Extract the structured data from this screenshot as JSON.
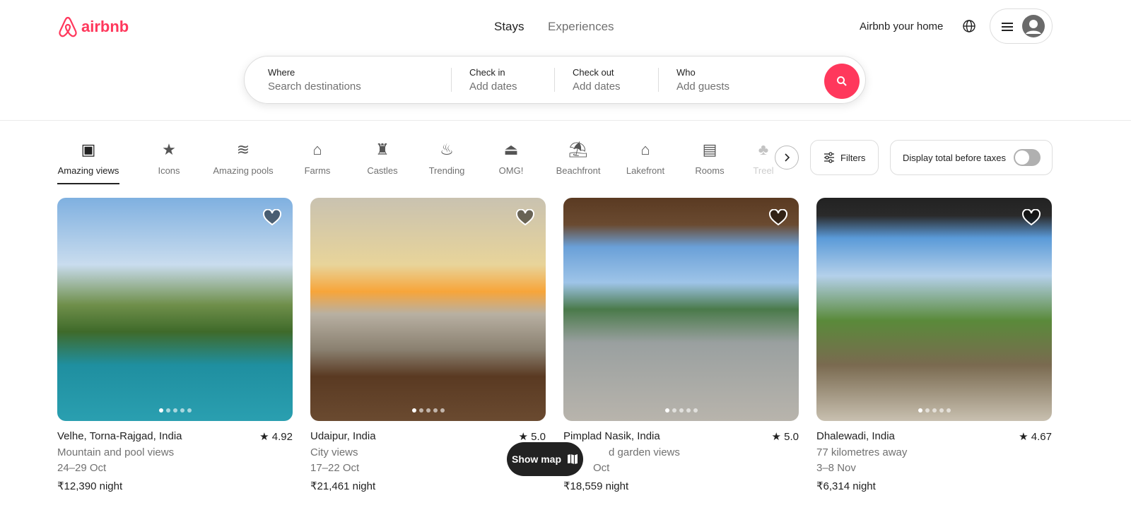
{
  "header": {
    "logo": "airbnb",
    "tabs": [
      {
        "label": "Stays"
      },
      {
        "label": "Experiences"
      }
    ],
    "host_link": "Airbnb your home"
  },
  "search": {
    "where": {
      "label": "Where",
      "placeholder": "Search destinations"
    },
    "checkin": {
      "label": "Check in",
      "placeholder": "Add dates"
    },
    "checkout": {
      "label": "Check out",
      "placeholder": "Add dates"
    },
    "who": {
      "label": "Who",
      "placeholder": "Add guests"
    }
  },
  "categories": [
    {
      "label": "Amazing views",
      "icon": "map-frame-icon"
    },
    {
      "label": "Icons",
      "icon": "ticket-star-icon"
    },
    {
      "label": "Amazing pools",
      "icon": "pool-icon"
    },
    {
      "label": "Farms",
      "icon": "barn-icon"
    },
    {
      "label": "Castles",
      "icon": "castle-icon"
    },
    {
      "label": "Trending",
      "icon": "flame-icon"
    },
    {
      "label": "OMG!",
      "icon": "ufo-icon"
    },
    {
      "label": "Beachfront",
      "icon": "beach-hut-icon"
    },
    {
      "label": "Lakefront",
      "icon": "lake-house-icon"
    },
    {
      "label": "Rooms",
      "icon": "bed-icon"
    },
    {
      "label": "Treel",
      "icon": "treehouse-icon"
    }
  ],
  "filters": {
    "label": "Filters",
    "taxes_label": "Display total before taxes",
    "taxes_on": false
  },
  "listings": [
    {
      "location": "Velhe, Torna-Rajgad, India",
      "rating": "4.92",
      "subtitle": "Mountain and pool views",
      "dates": "24–29 Oct",
      "price": "₹12,390",
      "unit": "night"
    },
    {
      "location": "Udaipur, India",
      "rating": "5.0",
      "subtitle": "City views",
      "dates": "17–22 Oct",
      "price": "₹21,461",
      "unit": "night"
    },
    {
      "location": "Pimplad Nasik, India",
      "rating": "5.0",
      "subtitle": "d garden views",
      "dates": "Oct",
      "price": "₹18,559",
      "unit": "night"
    },
    {
      "location": "Dhalewadi, India",
      "rating": "4.67",
      "subtitle": "77 kilometres away",
      "dates": "3–8 Nov",
      "price": "₹6,314",
      "unit": "night"
    }
  ],
  "show_map": "Show map",
  "colors": {
    "brand": "#ff385c"
  }
}
